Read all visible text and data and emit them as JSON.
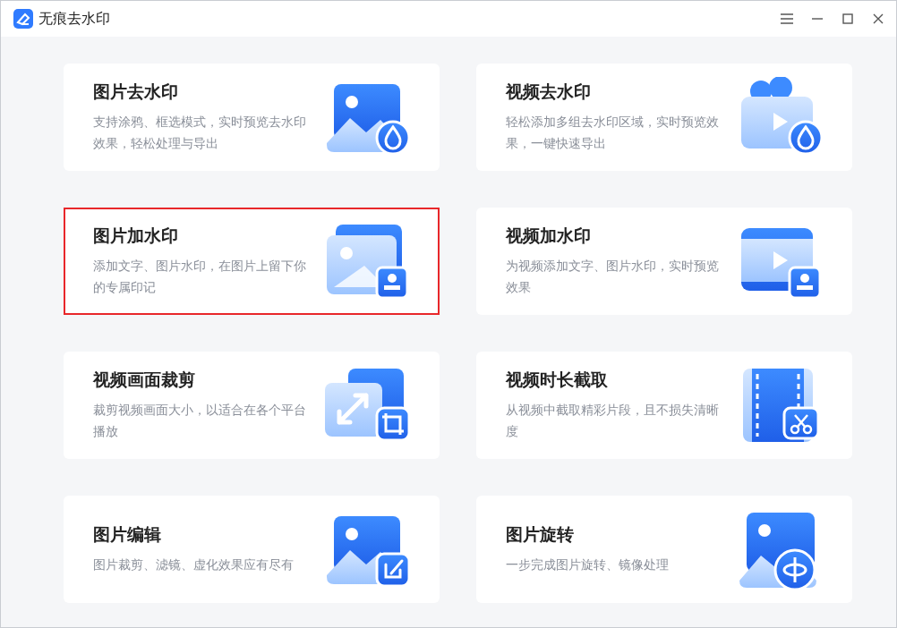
{
  "window": {
    "title": "无痕去水印"
  },
  "cards": [
    {
      "kind": "photo-drop",
      "title": "图片去水印",
      "description": "支持涂鸦、框选模式，实时预览去水印效果，轻松处理与导出",
      "selected": false
    },
    {
      "kind": "video-drop",
      "title": "视频去水印",
      "description": "轻松添加多组去水印区域，实时预览效果，一键快速导出",
      "selected": false
    },
    {
      "kind": "photo-stamp",
      "title": "图片加水印",
      "description": "添加文字、图片水印，在图片上留下你的专属印记",
      "selected": true
    },
    {
      "kind": "video-stamp",
      "title": "视频加水印",
      "description": "为视频添加文字、图片水印，实时预览效果",
      "selected": false
    },
    {
      "kind": "crop",
      "title": "视频画面裁剪",
      "description": "裁剪视频画面大小，以适合在各个平台播放",
      "selected": false
    },
    {
      "kind": "trim",
      "title": "视频时长截取",
      "description": "从视频中截取精彩片段，且不损失清晰度",
      "selected": false
    },
    {
      "kind": "edit",
      "title": "图片编辑",
      "description": "图片裁剪、滤镜、虚化效果应有尽有",
      "selected": false
    },
    {
      "kind": "rotate",
      "title": "图片旋转",
      "description": "一步完成图片旋转、镜像处理",
      "selected": false
    }
  ]
}
